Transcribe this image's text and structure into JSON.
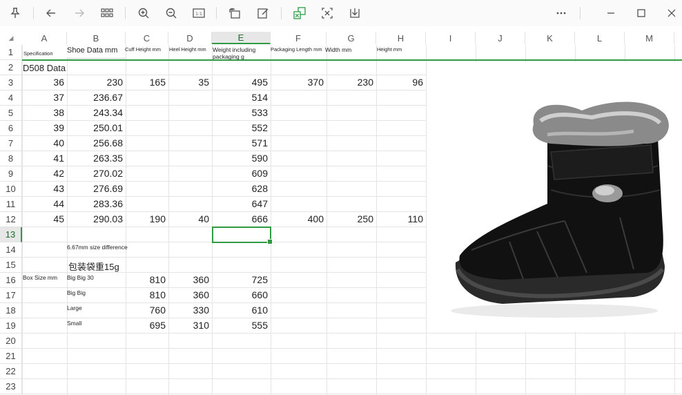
{
  "toolbar": {
    "icons": [
      "pin-icon",
      "back-arrow-icon",
      "forward-arrow-icon",
      "grid-view-icon",
      "zoom-in-icon",
      "zoom-out-icon",
      "actual-size-icon",
      "rotate-icon",
      "edit-icon",
      "excel-convert-icon",
      "crop-icon",
      "download-icon",
      "more-icon",
      "minimize-icon",
      "maximize-icon",
      "close-icon"
    ]
  },
  "columns": [
    "A",
    "B",
    "C",
    "D",
    "E",
    "F",
    "G",
    "H",
    "I",
    "J",
    "K",
    "L",
    "M"
  ],
  "selected_column": "E",
  "rows": [
    "1",
    "2",
    "3",
    "4",
    "5",
    "6",
    "7",
    "8",
    "9",
    "10",
    "11",
    "12",
    "13",
    "14",
    "15",
    "16",
    "17",
    "18",
    "19",
    "20",
    "21",
    "22",
    "23"
  ],
  "selected_row": "13",
  "header_row": {
    "a": "Specification",
    "b": "Shoe Data mm",
    "c": "Cuff Height mm",
    "d": "Heel Height mm",
    "e": "Weight including packaging g",
    "f": "Packaging Length mm",
    "g": "Width mm",
    "h": "Height mm"
  },
  "title_cell": "D508 Data",
  "data_rows": [
    {
      "a": "36",
      "b": "230",
      "c": "165",
      "d": "35",
      "e": "495",
      "f": "370",
      "g": "230",
      "h": "96"
    },
    {
      "a": "37",
      "b": "236.67",
      "c": "",
      "d": "",
      "e": "514",
      "f": "",
      "g": "",
      "h": ""
    },
    {
      "a": "38",
      "b": "243.34",
      "c": "",
      "d": "",
      "e": "533",
      "f": "",
      "g": "",
      "h": ""
    },
    {
      "a": "39",
      "b": "250.01",
      "c": "",
      "d": "",
      "e": "552",
      "f": "",
      "g": "",
      "h": ""
    },
    {
      "a": "40",
      "b": "256.68",
      "c": "",
      "d": "",
      "e": "571",
      "f": "",
      "g": "",
      "h": ""
    },
    {
      "a": "41",
      "b": "263.35",
      "c": "",
      "d": "",
      "e": "590",
      "f": "",
      "g": "",
      "h": ""
    },
    {
      "a": "42",
      "b": "270.02",
      "c": "",
      "d": "",
      "e": "609",
      "f": "",
      "g": "",
      "h": ""
    },
    {
      "a": "43",
      "b": "276.69",
      "c": "",
      "d": "",
      "e": "628",
      "f": "",
      "g": "",
      "h": ""
    },
    {
      "a": "44",
      "b": "283.36",
      "c": "",
      "d": "",
      "e": "647",
      "f": "",
      "g": "",
      "h": ""
    },
    {
      "a": "45",
      "b": "290.03",
      "c": "190",
      "d": "40",
      "e": "666",
      "f": "400",
      "g": "250",
      "h": "110"
    }
  ],
  "notes": {
    "size_diff": "6.67mm size difference",
    "bag_weight": "包装袋重15g"
  },
  "box_size": {
    "label": "Box Size mm",
    "rows": [
      {
        "name": "Big Big 30",
        "c": "810",
        "d": "360",
        "e": "725"
      },
      {
        "name": "Big Big",
        "c": "810",
        "d": "360",
        "e": "660"
      },
      {
        "name": "Large",
        "c": "760",
        "d": "330",
        "e": "610"
      },
      {
        "name": "Small",
        "c": "695",
        "d": "310",
        "e": "555"
      }
    ]
  },
  "image": {
    "subject": "black-snow-boot-with-fur-cuff"
  }
}
